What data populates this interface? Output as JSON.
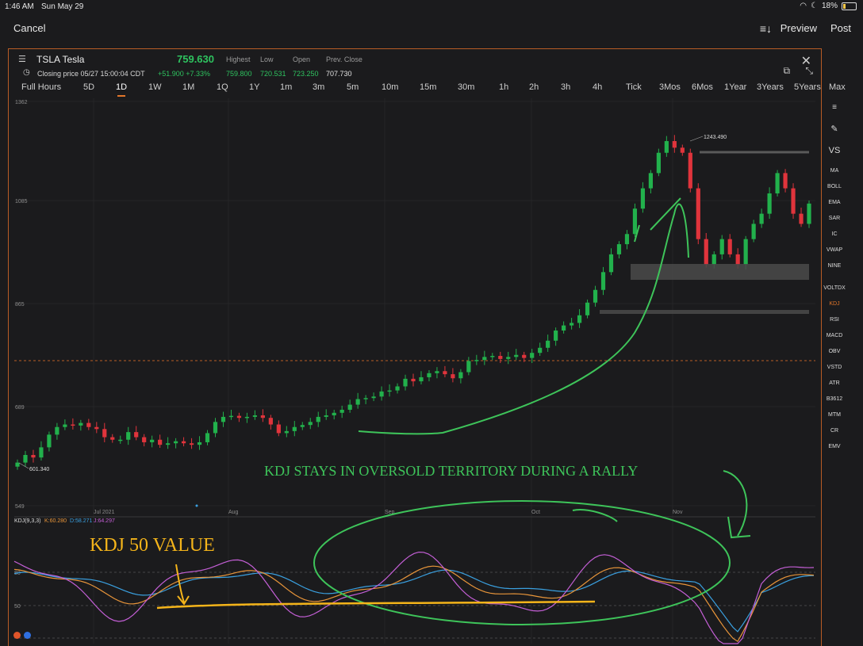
{
  "status_bar": {
    "time": "1:46 AM",
    "date": "Sun May 29",
    "battery": "18%"
  },
  "top_bar": {
    "cancel": "Cancel",
    "preview": "Preview",
    "post": "Post"
  },
  "header": {
    "symbol": "TSLA Tesla",
    "price": "759.630",
    "closing": "Closing price 05/27 15:00:04 CDT",
    "change": "+51.900  +7.33%",
    "stats": [
      {
        "label": "Highest",
        "value": "759.800",
        "color": "#2ec25f"
      },
      {
        "label": "Low",
        "value": "720.531",
        "color": "#2ec25f"
      },
      {
        "label": "Open",
        "value": "723.250",
        "color": "#2ec25f"
      },
      {
        "label": "Prev. Close",
        "value": "707.730",
        "color": "#e0e0e0"
      }
    ]
  },
  "tabs": [
    "Full Hours",
    "5D",
    "1D",
    "1W",
    "1M",
    "1Q",
    "1Y",
    "1m",
    "3m",
    "5m",
    "10m",
    "15m",
    "30m",
    "1h",
    "2h",
    "3h",
    "4h",
    "Tick",
    "3Mos",
    "6Mos",
    "1Year",
    "3Years",
    "5Years",
    "Max"
  ],
  "active_tab": "1D",
  "side_indicators": [
    "MA",
    "BOLL",
    "EMA",
    "SAR",
    "IC",
    "VWAP",
    "NINE",
    "VOLTDX",
    "KDJ",
    "RSI",
    "MACD",
    "OBV",
    "VSTD",
    "ATR",
    "B3612",
    "MTM",
    "CR",
    "EMV"
  ],
  "active_indicator": "KDJ",
  "side_vs": "VS",
  "kdj_legend": {
    "name": "KDJ(9,3,3)",
    "k": "K:60.280",
    "d": "D:58.271",
    "j": "J:64.297"
  },
  "annotations": {
    "green_text": "KDJ STAYS IN OVERSOLD TERRITORY DURING A RALLY",
    "yellow_text": "KDJ 50 VALUE"
  },
  "colors": {
    "up": "#22b14c",
    "down": "#e0343c",
    "accent": "#e2762a",
    "k": "#e8953a",
    "d": "#3aa0e0",
    "j": "#c45fd6",
    "annotation_green": "#3ec45a",
    "annotation_yellow": "#f4b41a"
  },
  "chart_data": {
    "type": "candlestick",
    "price_axis_ticks": [
      "1362",
      "1085",
      "865",
      "689",
      "549"
    ],
    "time_axis_labels": [
      "Jul 2021",
      "Aug",
      "Sep",
      "Oct",
      "Nov"
    ],
    "high_label": "1243.490",
    "low_label": "601.340",
    "kdj_axis_ticks": [
      "80",
      "50"
    ],
    "close_series": [
      610,
      625,
      620,
      640,
      665,
      680,
      685,
      683,
      688,
      680,
      676,
      660,
      655,
      655,
      670,
      660,
      650,
      655,
      645,
      648,
      652,
      648,
      645,
      650,
      668,
      690,
      700,
      702,
      698,
      700,
      703,
      698,
      685,
      668,
      672,
      680,
      684,
      690,
      700,
      703,
      708,
      714,
      724,
      735,
      737,
      740,
      750,
      752,
      760,
      775,
      770,
      778,
      786,
      790,
      784,
      776,
      788,
      810,
      812,
      818,
      820,
      814,
      818,
      822,
      816,
      826,
      836,
      850,
      870,
      880,
      885,
      900,
      925,
      950,
      985,
      1020,
      1040,
      1060,
      1110,
      1150,
      1180,
      1220,
      1243,
      1230,
      1220,
      1150,
      1050,
      1000,
      1020,
      1050,
      1020,
      1000,
      1050,
      1080,
      1100,
      1140,
      1180,
      1150,
      1100,
      1080,
      1120
    ]
  }
}
